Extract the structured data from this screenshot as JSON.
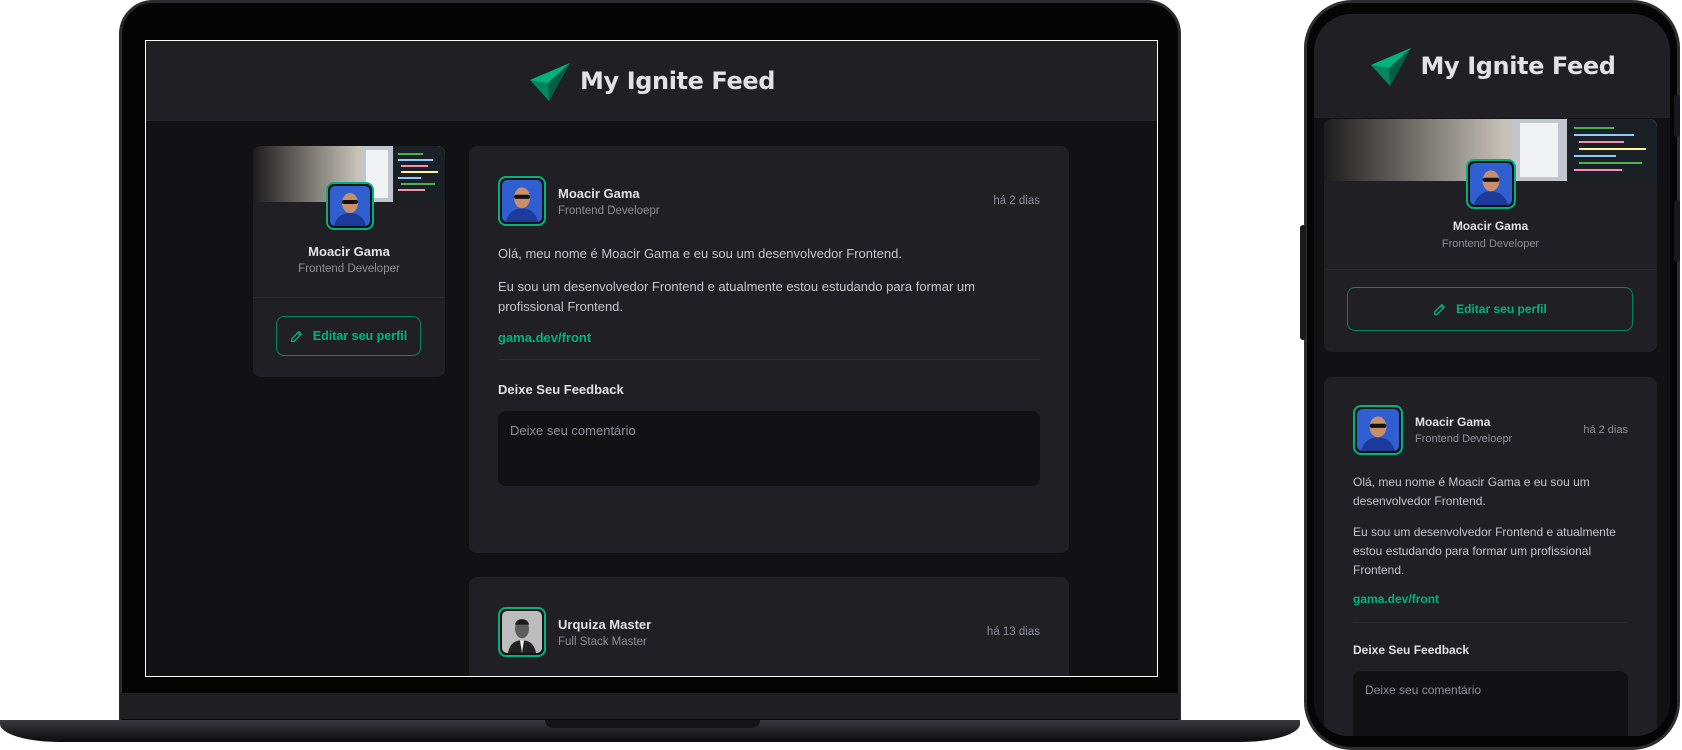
{
  "app": {
    "title": "My Ignite Feed"
  },
  "profile": {
    "name": "Moacir Gama",
    "role": "Frontend Developer",
    "edit_label": "Editar seu perfil"
  },
  "posts": [
    {
      "author_name": "Moacir Gama",
      "author_role": "Frontend Develoepr",
      "time": "há 2 dias",
      "paragraphs": [
        "Olá, meu nome é Moacir Gama e eu sou um desenvolvedor Frontend.",
        "Eu sou um desenvolvedor Frontend e atualmente estou estudando para formar um profissional Frontend."
      ],
      "link": "gama.dev/front",
      "feedback_title": "Deixe Seu Feedback",
      "comment_placeholder": "Deixe seu comentário"
    },
    {
      "author_name": "Urquiza Master",
      "author_role": "Full Stack Master",
      "time": "há 13 dias"
    }
  ],
  "colors": {
    "background": "#121214",
    "card": "#202024",
    "accent": "#00b37e",
    "accent_dark": "#00875f",
    "text": "#e1e1e6",
    "muted": "#8d8d99"
  },
  "icons": {
    "logo": "paper-plane-logo-icon",
    "edit": "pencil-icon"
  }
}
